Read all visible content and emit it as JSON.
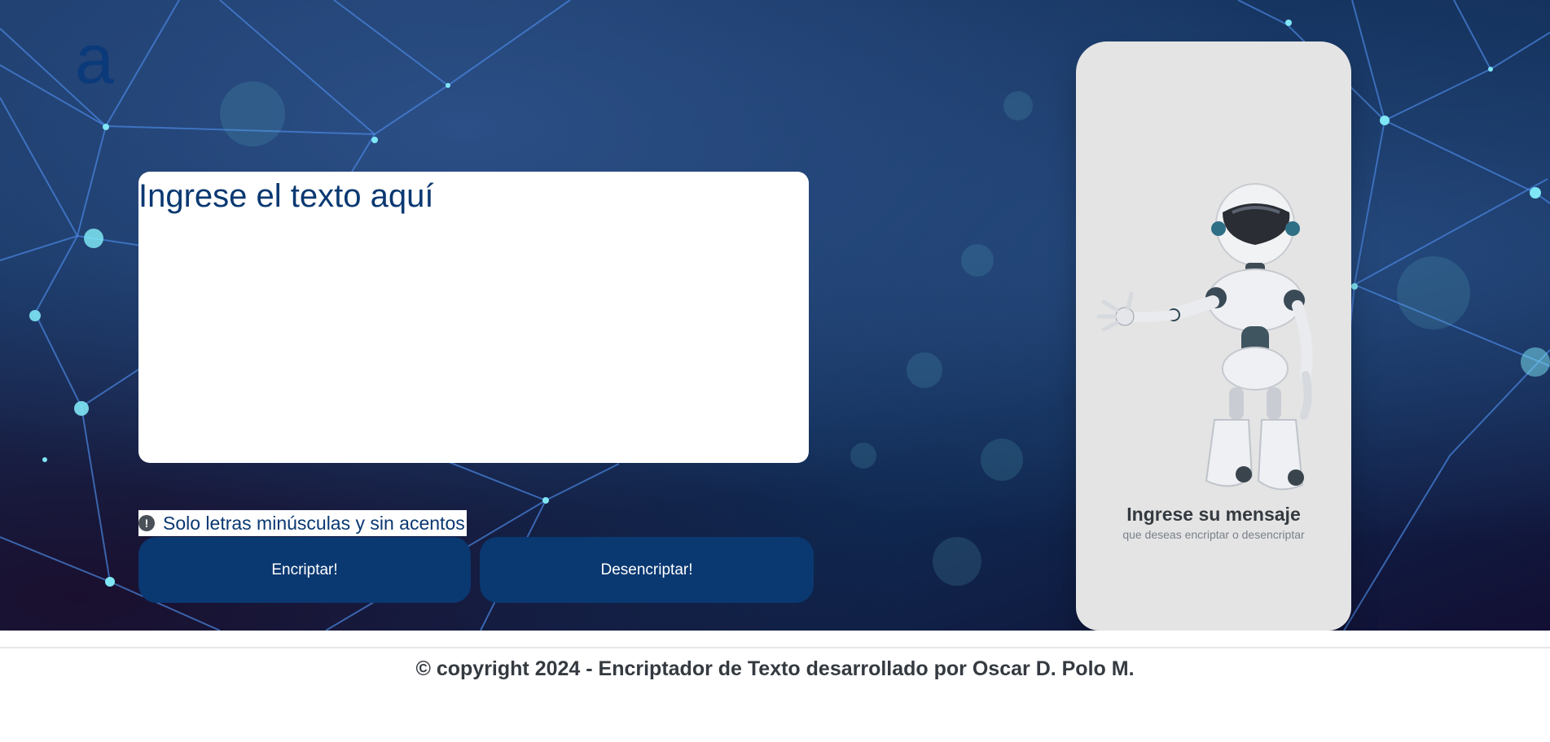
{
  "logo": {
    "text": "a"
  },
  "input": {
    "placeholder": "Ingrese el texto aquí",
    "value": ""
  },
  "hint": {
    "icon": "exclamation-circle-icon",
    "text": "Solo letras minúsculas y sin acentos"
  },
  "buttons": {
    "encrypt_label": "Encriptar!",
    "decrypt_label": "Desencriptar!"
  },
  "output_panel": {
    "image": "robot-illustration",
    "title": "Ingrese su mensaje",
    "subtitle": "que deseas encriptar o desencriptar"
  },
  "footer": {
    "text": "© copyright 2024 - Encriptador de Texto desarrollado por Oscar D. Polo M."
  },
  "colors": {
    "primary": "#0a3871",
    "panel_bg": "#e4e4e4",
    "hero_bg": "#13305a",
    "text_dark": "#343a40"
  }
}
